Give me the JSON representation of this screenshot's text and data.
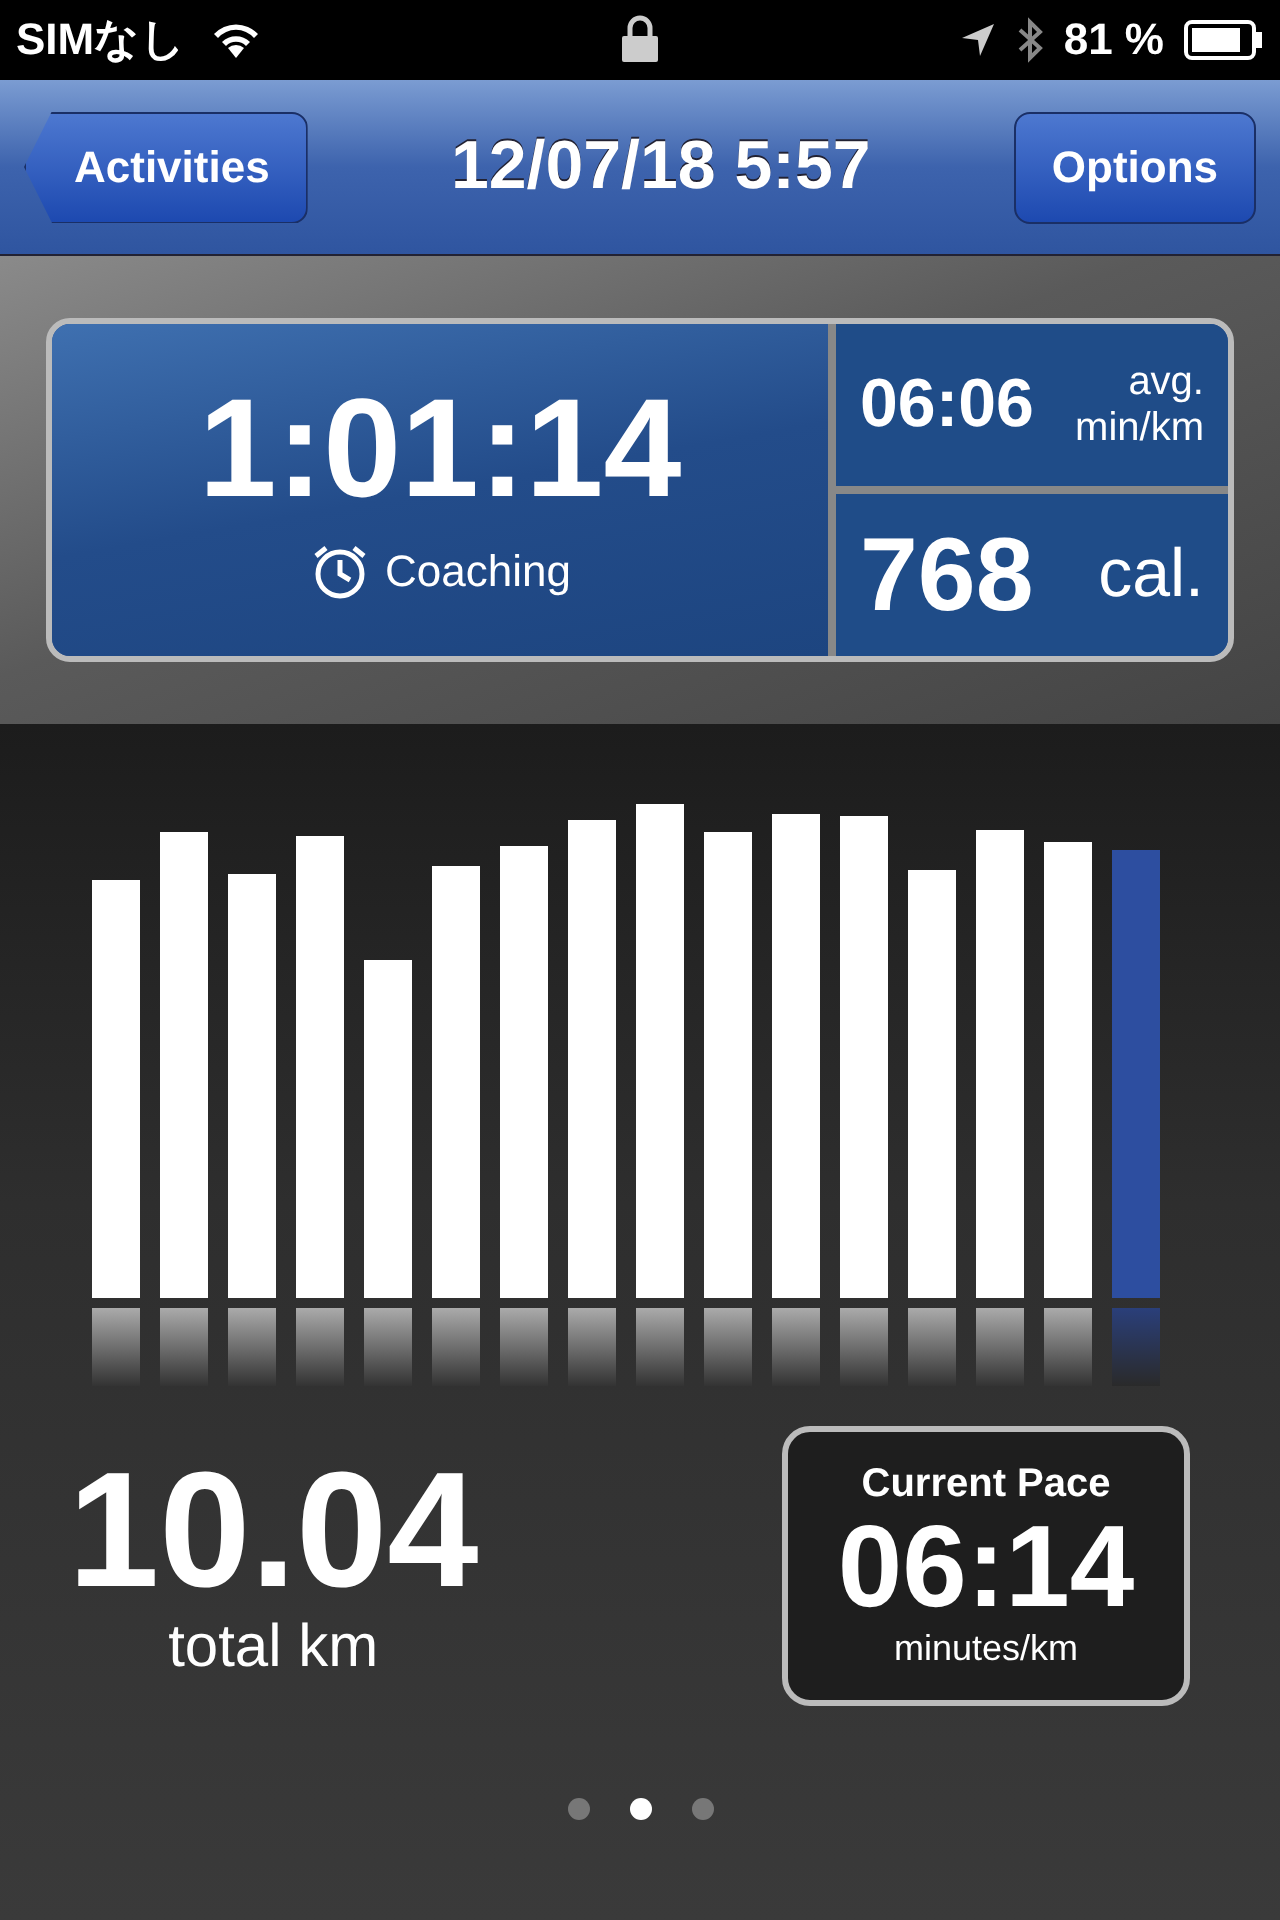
{
  "status_bar": {
    "carrier": "SIMなし",
    "battery": "81 %"
  },
  "nav_bar": {
    "back_button": "Activities",
    "title": "12/07/18 5:57",
    "options_button": "Options"
  },
  "summary": {
    "duration": "1:01:14",
    "coaching": "Coaching",
    "pace": "06:06",
    "pace_unit_1": "avg.",
    "pace_unit_2": "min/km",
    "calories": "768",
    "calories_unit": "cal."
  },
  "distance": {
    "value": "10.04",
    "label": "total km"
  },
  "current_pace": {
    "title": "Current Pace",
    "value": "06:14",
    "unit": "minutes/km"
  },
  "pages": [
    {
      "selected": false
    },
    {
      "selected": true
    },
    {
      "selected": false
    }
  ]
}
